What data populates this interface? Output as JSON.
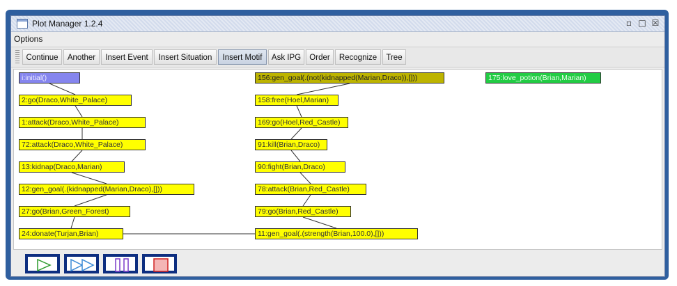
{
  "window": {
    "title": "Plot Manager 1.2.4",
    "controls": [
      "minimize-icon",
      "maximize-icon",
      "close-icon"
    ]
  },
  "menu": {
    "items": [
      "Options"
    ]
  },
  "toolbar": {
    "buttons": [
      {
        "label": "Continue",
        "active": false
      },
      {
        "label": "Another",
        "active": false
      },
      {
        "label": "Insert Event",
        "active": false
      },
      {
        "label": "Insert Situation",
        "active": false
      },
      {
        "label": "Insert Motif",
        "active": true
      },
      {
        "label": "Ask IPG",
        "active": false
      },
      {
        "label": "Order",
        "active": false
      },
      {
        "label": "Recognize",
        "active": false
      },
      {
        "label": "Tree",
        "active": false
      }
    ]
  },
  "graph": {
    "colors": {
      "yellow": "#ffff00",
      "olive": "#bdb400",
      "green": "#22cc44",
      "blue": "#8585ee",
      "edge": "#333333"
    },
    "nodes": [
      {
        "id": "n0",
        "label": "i:initial()",
        "color": "blue"
      },
      {
        "id": "n2",
        "label": "2:go(Draco,White_Palace)",
        "color": "yellow"
      },
      {
        "id": "n1",
        "label": "1:attack(Draco,White_Palace)",
        "color": "yellow"
      },
      {
        "id": "n72",
        "label": "72:attack(Draco,White_Palace)",
        "color": "yellow"
      },
      {
        "id": "n13",
        "label": "13:kidnap(Draco,Marian)",
        "color": "yellow"
      },
      {
        "id": "n12",
        "label": "12:gen_goal(.(kidnapped(Marian,Draco),[]))",
        "color": "yellow"
      },
      {
        "id": "n27",
        "label": "27:go(Brian,Green_Forest)",
        "color": "yellow"
      },
      {
        "id": "n24",
        "label": "24:donate(Turjan,Brian)",
        "color": "yellow"
      },
      {
        "id": "n156",
        "label": "156:gen_goal(.(not(kidnapped(Marian,Draco)),[]))",
        "color": "olive"
      },
      {
        "id": "n158",
        "label": "158:free(Hoel,Marian)",
        "color": "yellow"
      },
      {
        "id": "n169",
        "label": "169:go(Hoel,Red_Castle)",
        "color": "yellow"
      },
      {
        "id": "n91",
        "label": "91:kill(Brian,Draco)",
        "color": "yellow"
      },
      {
        "id": "n90",
        "label": "90:fight(Brian,Draco)",
        "color": "yellow"
      },
      {
        "id": "n78",
        "label": "78:attack(Brian,Red_Castle)",
        "color": "yellow"
      },
      {
        "id": "n79",
        "label": "79:go(Brian,Red_Castle)",
        "color": "yellow"
      },
      {
        "id": "n11",
        "label": "11:gen_goal(.(strength(Brian,100.0),[]))",
        "color": "yellow"
      },
      {
        "id": "n175",
        "label": "175:love_potion(Brian,Marian)",
        "color": "green"
      }
    ],
    "edges": [
      [
        "n0",
        "n2"
      ],
      [
        "n2",
        "n1"
      ],
      [
        "n1",
        "n72"
      ],
      [
        "n72",
        "n13"
      ],
      [
        "n13",
        "n12"
      ],
      [
        "n12",
        "n27"
      ],
      [
        "n27",
        "n24"
      ],
      [
        "n24",
        "n11"
      ],
      [
        "n156",
        "n158"
      ],
      [
        "n158",
        "n169"
      ],
      [
        "n169",
        "n91"
      ],
      [
        "n91",
        "n90"
      ],
      [
        "n90",
        "n78"
      ],
      [
        "n78",
        "n79"
      ],
      [
        "n79",
        "n11"
      ]
    ]
  },
  "playback": {
    "buttons": [
      {
        "name": "play-icon"
      },
      {
        "name": "fast-forward-icon"
      },
      {
        "name": "pause-icon"
      },
      {
        "name": "stop-icon"
      }
    ]
  }
}
